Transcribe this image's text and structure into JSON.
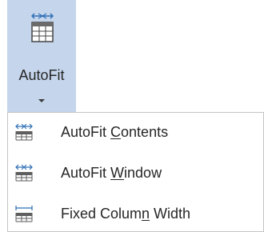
{
  "autofit_button": {
    "label": "AutoFit",
    "icon": "table-autofit-icon"
  },
  "menu": {
    "items": [
      {
        "label_before": "AutoFit ",
        "mnemonic": "C",
        "label_after": "ontents",
        "icon": "autofit-contents-icon"
      },
      {
        "label_before": "AutoFit ",
        "mnemonic": "W",
        "label_after": "indow",
        "icon": "autofit-window-icon"
      },
      {
        "label_before": "Fixed Colum",
        "mnemonic": "n",
        "label_after": " Width",
        "icon": "fixed-column-width-icon"
      }
    ]
  },
  "colors": {
    "button_highlight": "#c5d5ec",
    "icon_blue": "#2e6fb5",
    "text": "#262626",
    "menu_border": "#c6c6c6"
  }
}
